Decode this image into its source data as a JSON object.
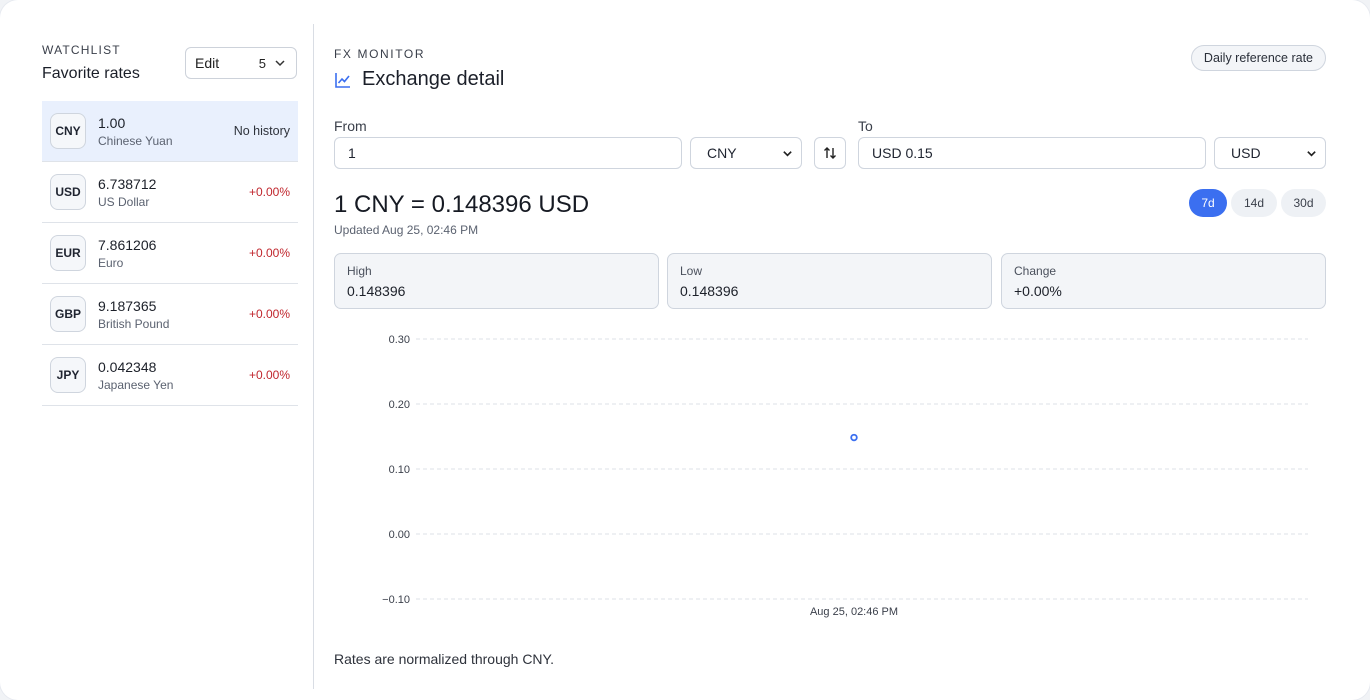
{
  "watchlist": {
    "eyebrow": "WATCHLIST",
    "title": "Favorite rates",
    "edit_label": "Edit",
    "count_value": "5",
    "items": [
      {
        "code": "CNY",
        "rate": "1.00",
        "name": "Chinese Yuan",
        "change": "No history",
        "active": true
      },
      {
        "code": "USD",
        "rate": "6.738712",
        "name": "US Dollar",
        "change": "+0.00%"
      },
      {
        "code": "EUR",
        "rate": "7.861206",
        "name": "Euro",
        "change": "+0.00%"
      },
      {
        "code": "GBP",
        "rate": "9.187365",
        "name": "British Pound",
        "change": "+0.00%"
      },
      {
        "code": "JPY",
        "rate": "0.042348",
        "name": "Japanese Yen",
        "change": "+0.00%"
      }
    ]
  },
  "header": {
    "eyebrow": "FX MONITOR",
    "title": "Exchange detail",
    "reference_badge": "Daily reference rate"
  },
  "converter": {
    "from_label": "From",
    "from_value": "1",
    "from_currency": "CNY",
    "to_label": "To",
    "to_value": "USD 0.15",
    "to_currency": "USD"
  },
  "summary": {
    "headline": "1 CNY = 0.148396 USD",
    "updated": "Updated Aug 25, 02:46 PM",
    "ranges": [
      {
        "label": "7d",
        "active": true
      },
      {
        "label": "14d"
      },
      {
        "label": "30d"
      }
    ]
  },
  "stats": {
    "high_label": "High",
    "high_value": "0.148396",
    "low_label": "Low",
    "low_value": "0.148396",
    "change_label": "Change",
    "change_value": "+0.00%"
  },
  "chart_data": {
    "type": "line",
    "x": [
      "Aug 25, 02:46 PM"
    ],
    "series": [
      {
        "values": [
          0.148396
        ]
      }
    ],
    "yticks": [
      "0.30",
      "0.20",
      "0.10",
      "0.00",
      "−0.10"
    ],
    "ylim": [
      -0.1,
      0.3
    ],
    "grid": true,
    "accent": "#3b6ff0"
  },
  "footnote": "Rates are normalized through CNY.",
  "colors": {
    "accent": "#3b6ff0",
    "negative": "#c0262d"
  }
}
